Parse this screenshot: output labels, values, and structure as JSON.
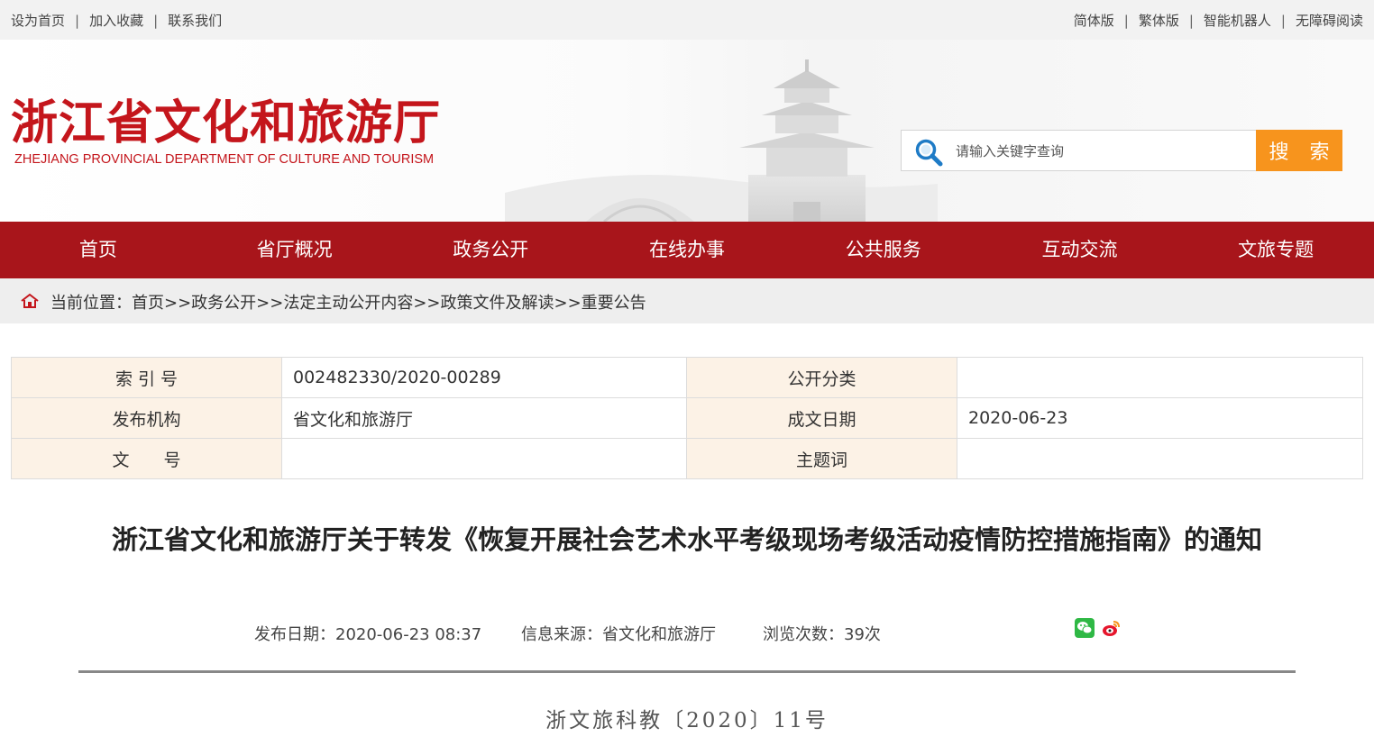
{
  "topbar": {
    "left_links": [
      "设为首页",
      "加入收藏",
      "联系我们"
    ],
    "right_links": [
      "简体版",
      "繁体版",
      "智能机器人",
      "无障碍阅读"
    ],
    "separator": "|"
  },
  "header": {
    "logo_cn": "浙江省文化和旅游厅",
    "logo_en": "ZHEJIANG PROVINCIAL DEPARTMENT OF CULTURE AND TOURISM",
    "search_placeholder": "请输入关键字查询",
    "search_button": "搜 索"
  },
  "nav": {
    "items": [
      "首页",
      "省厅概况",
      "政务公开",
      "在线办事",
      "公共服务",
      "互动交流",
      "文旅专题"
    ]
  },
  "breadcrumb": {
    "text": "当前位置：首页>>政务公开>>法定主动公开内容>>政策文件及解读>>重要公告"
  },
  "meta_table": {
    "rows": [
      {
        "label1": "索 引 号",
        "value1": "002482330/2020-00289",
        "label2": "公开分类",
        "value2": ""
      },
      {
        "label1": "发布机构",
        "value1": "省文化和旅游厅",
        "label2": "成文日期",
        "value2": "2020-06-23"
      },
      {
        "label1": "文　　号",
        "value1": "",
        "label2": "主题词",
        "value2": ""
      }
    ]
  },
  "article": {
    "title": "浙江省文化和旅游厅关于转发《恢复开展社会艺术水平考级现场考级活动疫情防控措施指南》的通知",
    "publish_date": "发布日期：2020-06-23 08:37",
    "source": "信息来源：省文化和旅游厅",
    "views": "浏览次数：39次",
    "doc_number": "浙文旅科教〔2020〕11号"
  },
  "colors": {
    "brand_red": "#a8151b",
    "logo_red": "#c4161c",
    "search_orange": "#f7941d",
    "label_bg": "#fcf2e6"
  },
  "icons": {
    "search": "search-icon",
    "home": "home-icon",
    "wechat": "wechat-icon",
    "weibo": "weibo-icon"
  }
}
